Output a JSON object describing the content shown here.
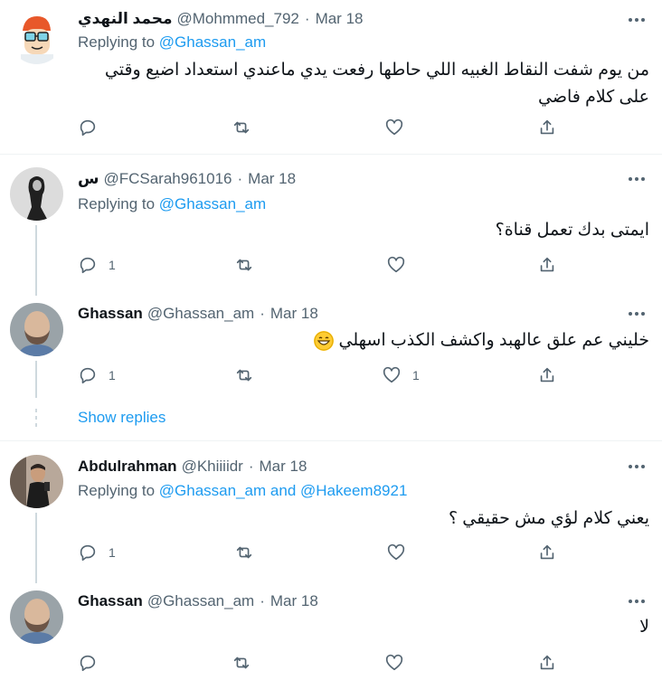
{
  "tweets": [
    {
      "name": "محمد النهدي",
      "handle": "@Mohmmed_792",
      "date": "Mar 18",
      "replying_prefix": "Replying to",
      "replying_to": "@Ghassan_am",
      "replying_and": "",
      "replying_to2": "",
      "text_line1": "من يوم شفت النقاط الغبيه اللي حاطها رفعت يدي ماعندي استعداد اضيع وقتي",
      "text_line2": "على كلام فاضي",
      "reply_count": "",
      "like_count": "",
      "avatar": "cartoon-avatar"
    },
    {
      "name": "س",
      "handle": "@FCSarah961016",
      "date": "Mar 18",
      "replying_prefix": "Replying to",
      "replying_to": "@Ghassan_am",
      "text": "ايمتى بدك تعمل قناة؟",
      "reply_count": "1",
      "like_count": ""
    },
    {
      "name": "Ghassan",
      "handle": "@Ghassan_am",
      "date": "Mar 18",
      "text": "خليني عم علق عالهبد واكشف الكذب اسهلي",
      "emoji": "grinning-emoji",
      "reply_count": "1",
      "like_count": "1"
    },
    {
      "name": "Abdulrahman",
      "handle": "@Khiiiidr",
      "date": "Mar 18",
      "replying_prefix": "Replying to",
      "replying_to": "@Ghassan_am",
      "replying_and": "and",
      "replying_to2": "@Hakeem8921",
      "text": "يعني كلام لؤي مش حقيقي ؟",
      "reply_count": "1",
      "like_count": ""
    },
    {
      "name": "Ghassan",
      "handle": "@Ghassan_am",
      "date": "Mar 18",
      "text": "لا",
      "reply_count": "",
      "like_count": ""
    }
  ],
  "show_replies": "Show replies",
  "colors": {
    "link": "#1d9bf0",
    "secondary": "#536471",
    "divider": "#eff3f4"
  }
}
